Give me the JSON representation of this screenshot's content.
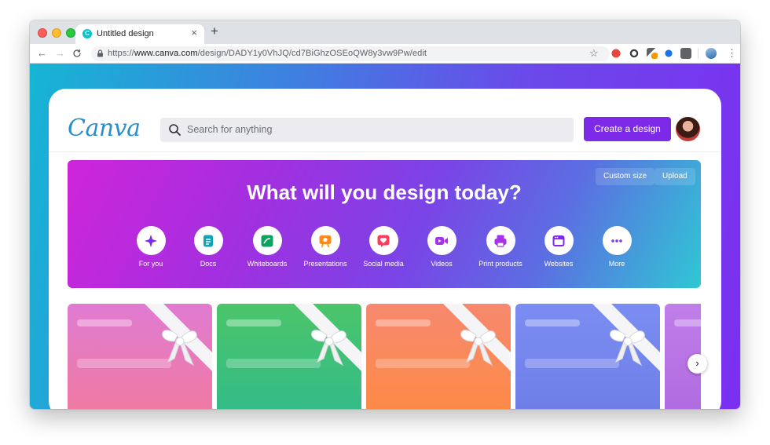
{
  "browser": {
    "tab_title": "Untitled design",
    "tab_favicon_letter": "C",
    "tab_close": "×",
    "new_tab": "+",
    "nav": {
      "back": "←",
      "forward": "→",
      "reload": "C"
    },
    "url_prefix": "https://",
    "url_domain": "www.canva.com",
    "url_path": "/design/DADY1y0VhJQ/cd7BiGhzOSEoQW8y3vw9Pw/edit",
    "bookmark_star": "☆",
    "menu": "⋮",
    "extensions": [
      "ext-red-icon",
      "ext-chrome-icon",
      "ext-tool-icon",
      "ext-blue-dot-icon",
      "ext-gray-icon",
      "ext-profile-icon"
    ]
  },
  "header": {
    "logo": "Canva",
    "search_placeholder": "Search for anything",
    "create_button": "Create a design"
  },
  "hero": {
    "title": "What will you design today?",
    "custom_size": "Custom size",
    "upload": "Upload",
    "categories": [
      {
        "label": "For you",
        "icon": "sparkle-icon",
        "color": "#7d2ae8"
      },
      {
        "label": "Docs",
        "icon": "doc-icon",
        "color": "#13a3b5"
      },
      {
        "label": "Whiteboards",
        "icon": "whiteboard-icon",
        "color": "#0ba360"
      },
      {
        "label": "Presentations",
        "icon": "presentation-icon",
        "color": "#ff8a1a"
      },
      {
        "label": "Social media",
        "icon": "heart-icon",
        "color": "#ff3b5c"
      },
      {
        "label": "Videos",
        "icon": "video-icon",
        "color": "#a633e8"
      },
      {
        "label": "Print products",
        "icon": "printer-icon",
        "color": "#a633e8"
      },
      {
        "label": "Websites",
        "icon": "browser-window-icon",
        "color": "#7d2ae8"
      },
      {
        "label": "More",
        "icon": "more-dots-icon",
        "color": "#7d2ae8"
      }
    ]
  },
  "tiles": [
    {
      "name": "tile-1",
      "colors": [
        "#e27cd4",
        "#f2779a"
      ]
    },
    {
      "name": "tile-2",
      "colors": [
        "#49c46a",
        "#2fb88a"
      ]
    },
    {
      "name": "tile-3",
      "colors": [
        "#f68d6b",
        "#ff8a3d"
      ]
    },
    {
      "name": "tile-4",
      "colors": [
        "#7a8cf2",
        "#6f7ee8"
      ]
    },
    {
      "name": "tile-5",
      "colors": [
        "#c07ee8",
        "#b06ae0"
      ]
    }
  ],
  "next_arrow": "›",
  "colors": {
    "accent": "#7d2ae8",
    "logo": "#2b8ec9"
  }
}
